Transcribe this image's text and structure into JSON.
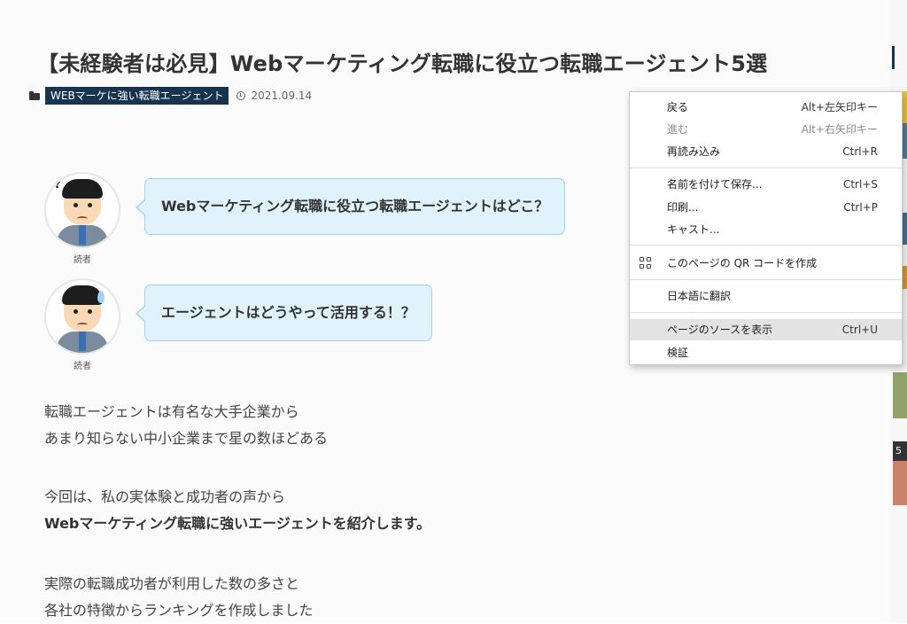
{
  "article": {
    "title": "【未経験者は必見】Webマーケティング転職に役立つ転職エージェント5選",
    "category": "WEBマーケに強い転職エージェント",
    "date": "2021.09.14"
  },
  "speeches": [
    {
      "name": "読者",
      "text": "Webマーケティング転職に役立つ転職エージェントはどこ？"
    },
    {
      "name": "読者",
      "text": "エージェントはどうやって活用する！？"
    }
  ],
  "body": {
    "p1": [
      "転職エージェントは有名な大手企業から",
      "あまり知らない中小企業まで星の数ほどある"
    ],
    "p2": [
      "今回は、私の実体験と成功者の声から",
      "Webマーケティング転職に強いエージェントを紹介します。"
    ],
    "p3": [
      "実際の転職成功者が利用した数の多さと",
      "各社の特徴からランキングを作成しました"
    ]
  },
  "sidebar": {
    "rank_label": "5"
  },
  "context_menu": {
    "items": [
      {
        "label": "戻る",
        "shortcut": "Alt+左矢印キー"
      },
      {
        "label": "進む",
        "shortcut": "Alt+右矢印キー"
      },
      {
        "label": "再読み込み",
        "shortcut": "Ctrl+R"
      },
      {
        "label": "名前を付けて保存...",
        "shortcut": "Ctrl+S"
      },
      {
        "label": "印刷...",
        "shortcut": "Ctrl+P"
      },
      {
        "label": "キャスト..."
      },
      {
        "label": "このページの QR コードを作成",
        "icon": "qr-code-icon"
      },
      {
        "label": "日本語に翻訳"
      },
      {
        "label": "ページのソースを表示",
        "shortcut": "Ctrl+U"
      },
      {
        "label": "検証"
      }
    ]
  },
  "colors": {
    "category_tag_bg": "#17344f",
    "bubble_bg": "#e0f3fd",
    "bubble_border": "#9fd3ea",
    "menu_highlight": "#e3e3e3"
  }
}
